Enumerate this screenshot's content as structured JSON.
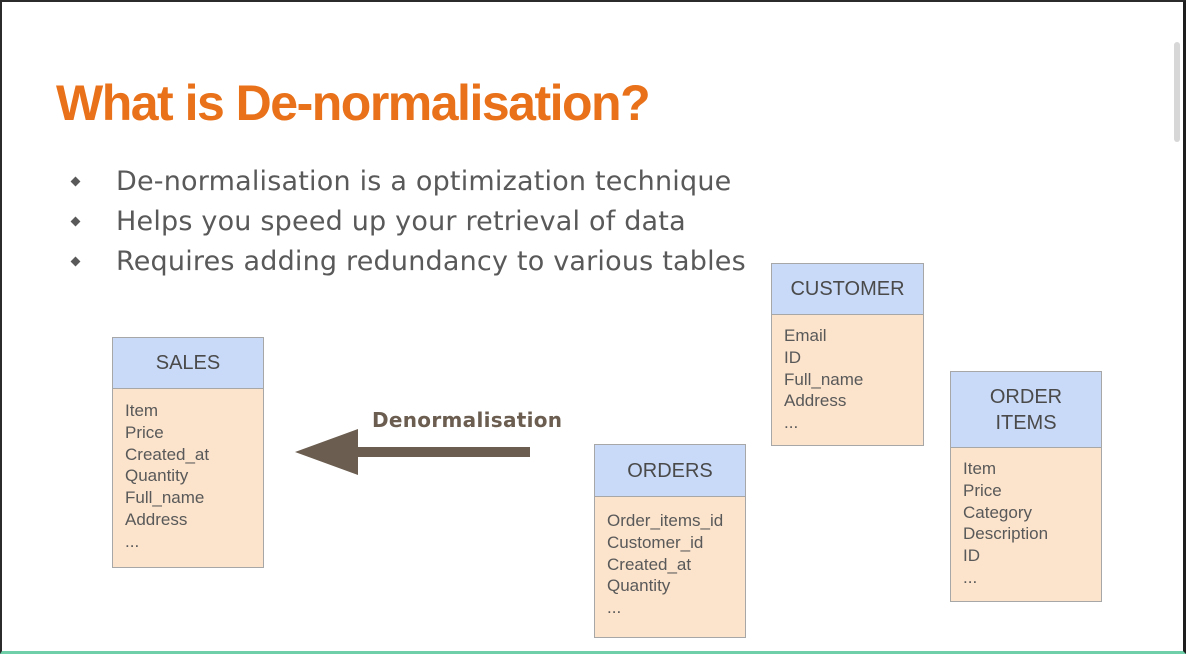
{
  "slide": {
    "title": "What is De-normalisation?",
    "bullets": [
      "De-normalisation is a optimization technique",
      "Helps you speed up your retrieval of data",
      "Requires adding redundancy to various tables"
    ],
    "arrow_label": "Denormalisation"
  },
  "tables": {
    "sales": {
      "name": "SALES",
      "fields": [
        "Item",
        "Price",
        "Created_at",
        "Quantity",
        "Full_name",
        "Address",
        "..."
      ]
    },
    "orders": {
      "name": "ORDERS",
      "fields": [
        "Order_items_id",
        "Customer_id",
        "Created_at",
        "Quantity",
        "..."
      ]
    },
    "customer": {
      "name": "CUSTOMER",
      "fields": [
        "Email",
        "ID",
        "Full_name",
        "Address",
        "..."
      ]
    },
    "order_items": {
      "name_line1": "ORDER",
      "name_line2": "ITEMS",
      "fields": [
        "Item",
        "Price",
        "Category",
        "Description",
        "ID",
        "..."
      ]
    }
  },
  "colors": {
    "title": "#e8711a",
    "bullet_text": "#595959",
    "table_header": "#c9daf8",
    "table_body": "#fbe3cc",
    "arrow": "#6b5d4f"
  }
}
